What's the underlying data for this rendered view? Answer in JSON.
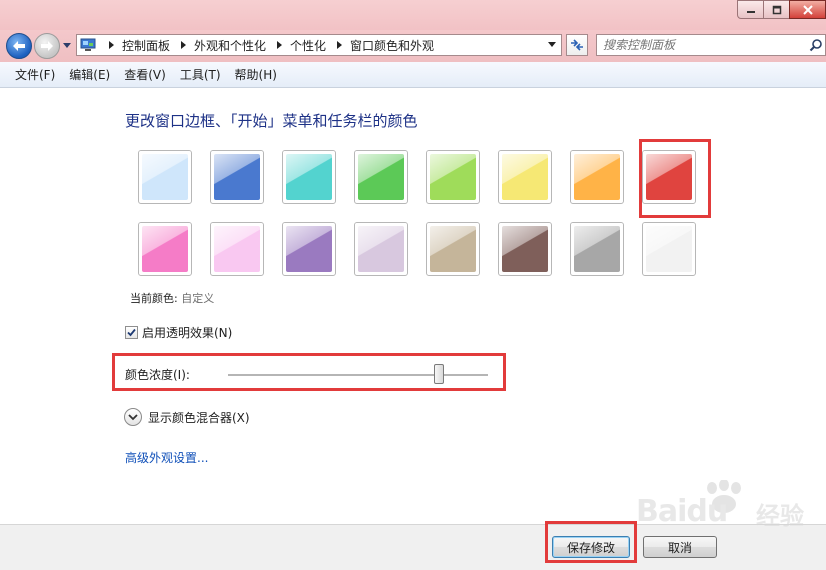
{
  "window": {
    "minimize_icon": "minimize-icon",
    "maximize_icon": "maximize-icon",
    "close_icon": "close-icon"
  },
  "nav": {
    "breadcrumbs": [
      "控制面板",
      "外观和个性化",
      "个性化",
      "窗口颜色和外观"
    ],
    "search_placeholder": "搜索控制面板"
  },
  "menu": [
    "文件(F)",
    "编辑(E)",
    "查看(V)",
    "工具(T)",
    "帮助(H)"
  ],
  "main": {
    "title": "更改窗口边框、「开始」菜单和任务栏的颜色",
    "swatch_colors_row1": [
      "#cfe6fb",
      "#4a79cf",
      "#53d3cf",
      "#5cc957",
      "#9fdc5a",
      "#f6e874",
      "#ffb347",
      "#e0443f"
    ],
    "swatch_colors_row2": [
      "#f57cc7",
      "#f9c8f1",
      "#9a7ac0",
      "#d8c8df",
      "#c5b59a",
      "#7f5f5a",
      "#a7a7a7",
      "#f2f2f2"
    ],
    "selected_swatch": 8,
    "current_color_label": "当前颜色:",
    "current_color_value": "自定义",
    "transparency_label": "启用透明效果(N)",
    "transparency_checked": true,
    "intensity_label": "颜色浓度(I):",
    "intensity_value_pct": 81,
    "mixer_label": "显示颜色混合器(X)",
    "advanced_link": "高级外观设置..."
  },
  "footer": {
    "save_label": "保存修改",
    "cancel_label": "取消"
  },
  "watermark": {
    "brand": "Baidu",
    "sub": "经验"
  },
  "colors": {
    "highlight_box": "#e23b3b",
    "link": "#0f4fb8",
    "title_text": "#1e3287"
  }
}
